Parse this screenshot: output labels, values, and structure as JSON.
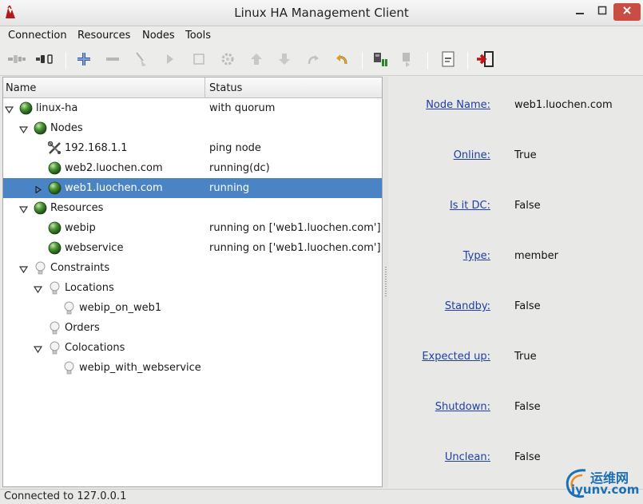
{
  "window": {
    "title": "Linux HA Management Client"
  },
  "menu": [
    "Connection",
    "Resources",
    "Nodes",
    "Tools"
  ],
  "toolbar_icons": [
    "connect-icon",
    "disconnect-icon",
    "add-icon",
    "remove-icon",
    "cleanup-icon",
    "start-icon",
    "stop-icon",
    "migrate-icon",
    "move-up-icon",
    "move-down-icon",
    "redo-icon",
    "undo-icon",
    "standby-icon",
    "active-icon",
    "view-xml-icon",
    "exit-icon"
  ],
  "tree": {
    "columns": {
      "name": "Name",
      "status": "Status"
    },
    "rows": [
      {
        "label": "linux-ha",
        "status": "with quorum",
        "icon": "green-ball-icon",
        "expander": "down"
      },
      {
        "label": "Nodes",
        "status": "",
        "icon": "green-ball-icon",
        "expander": "down"
      },
      {
        "label": "192.168.1.1",
        "status": "ping node",
        "icon": "tools-icon",
        "expander": ""
      },
      {
        "label": "web2.luochen.com",
        "status": "running(dc)",
        "icon": "green-ball-icon",
        "expander": ""
      },
      {
        "label": "web1.luochen.com",
        "status": "running",
        "icon": "green-ball-icon",
        "expander": "right",
        "selected": true
      },
      {
        "label": "Resources",
        "status": "",
        "icon": "green-ball-icon",
        "expander": "down"
      },
      {
        "label": "webip",
        "status": "running on ['web1.luochen.com']",
        "icon": "green-ball-icon",
        "expander": ""
      },
      {
        "label": "webservice",
        "status": "running on ['web1.luochen.com']",
        "icon": "green-ball-icon",
        "expander": ""
      },
      {
        "label": "Constraints",
        "status": "",
        "icon": "light-bulb-icon",
        "expander": "down"
      },
      {
        "label": "Locations",
        "status": "",
        "icon": "light-bulb-icon",
        "expander": "down"
      },
      {
        "label": "webip_on_web1",
        "status": "",
        "icon": "light-bulb-icon",
        "expander": ""
      },
      {
        "label": "Orders",
        "status": "",
        "icon": "light-bulb-icon",
        "expander": ""
      },
      {
        "label": "Colocations",
        "status": "",
        "icon": "light-bulb-icon",
        "expander": "down"
      },
      {
        "label": "webip_with_webservice",
        "status": "",
        "icon": "light-bulb-icon",
        "expander": ""
      }
    ]
  },
  "details": [
    {
      "label": "Node Name:",
      "value": "web1.luochen.com"
    },
    {
      "label": "Online:",
      "value": "True"
    },
    {
      "label": "Is it DC:",
      "value": "False"
    },
    {
      "label": "Type:",
      "value": "member"
    },
    {
      "label": "Standby:",
      "value": "False"
    },
    {
      "label": "Expected up:",
      "value": "True"
    },
    {
      "label": "Shutdown:",
      "value": "False"
    },
    {
      "label": "Unclean:",
      "value": "False"
    }
  ],
  "status_bar": "Connected to 127.0.0.1",
  "watermark": {
    "cn": "运维网",
    "en": "iyunv.com"
  },
  "colors": {
    "selection": "#4a84c5",
    "link": "#1f3ea6",
    "close_button": "#c94d42"
  }
}
